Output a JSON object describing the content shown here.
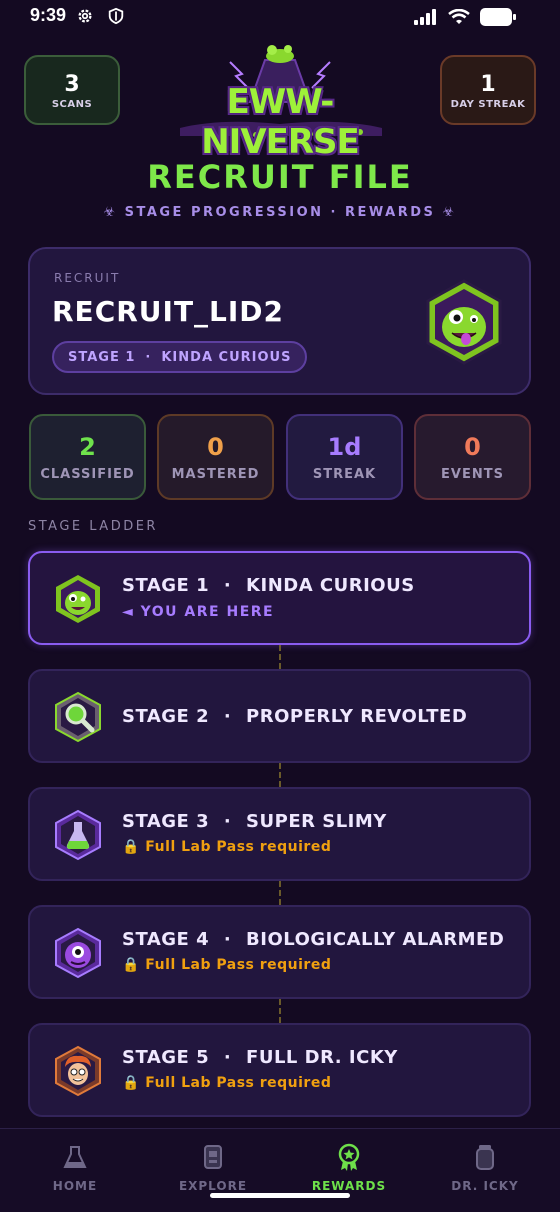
{
  "status_bar": {
    "time": "9:39"
  },
  "header": {
    "scans": {
      "count": "3",
      "label": "SCANS"
    },
    "streak": {
      "count": "1",
      "label": "DAY STREAK"
    },
    "logo_text": "EWW-NIVERSE"
  },
  "page": {
    "title": "RECRUIT FILE",
    "subtitle": "☣ STAGE PROGRESSION · REWARDS ☣"
  },
  "recruit": {
    "label": "RECRUIT",
    "name": "RECRUIT_LID2",
    "stage_pill": "STAGE 1",
    "stage_pill_name": "KINDA CURIOUS"
  },
  "stats": [
    {
      "value": "2",
      "label": "CLASSIFIED",
      "color": "#6fe24c"
    },
    {
      "value": "0",
      "label": "MASTERED",
      "color": "#f0a04a"
    },
    {
      "value": "1d",
      "label": "STREAK",
      "color": "#a77cff"
    },
    {
      "value": "0",
      "label": "EVENTS",
      "color": "#f07a5a"
    }
  ],
  "ladder_label": "STAGE LADDER",
  "stages": [
    {
      "stage": "STAGE 1",
      "name": "KINDA CURIOUS",
      "note": "◄ YOU ARE HERE",
      "note_color": "#a77cff",
      "icon": "slime-creature-icon"
    },
    {
      "stage": "STAGE 2",
      "name": "PROPERLY REVOLTED",
      "note": "",
      "note_color": "",
      "icon": "magnifier-icon"
    },
    {
      "stage": "STAGE 3",
      "name": "SUPER SLIMY",
      "note": "🔒 Full Lab Pass required",
      "note_color": "#f0a010",
      "icon": "flask-icon"
    },
    {
      "stage": "STAGE 4",
      "name": "BIOLOGICALLY ALARMED",
      "note": "🔒 Full Lab Pass required",
      "note_color": "#f0a010",
      "icon": "eyeball-monster-icon"
    },
    {
      "stage": "STAGE 5",
      "name": "FULL DR. ICKY",
      "note": "🔒 Full Lab Pass required",
      "note_color": "#f0a010",
      "icon": "dr-icky-icon"
    }
  ],
  "nav": [
    {
      "label": "HOME",
      "icon": "beaker-icon",
      "active": false
    },
    {
      "label": "EXPLORE",
      "icon": "scanner-icon",
      "active": false
    },
    {
      "label": "REWARDS",
      "icon": "award-icon",
      "active": true
    },
    {
      "label": "DR. ICKY",
      "icon": "specimen-jar-icon",
      "active": false
    }
  ]
}
